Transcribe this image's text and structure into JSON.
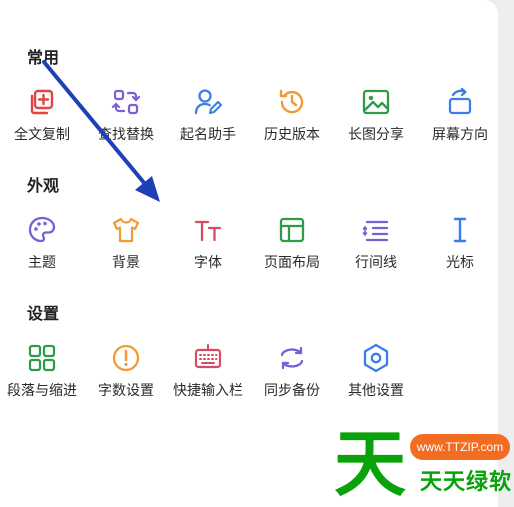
{
  "sections": {
    "common": {
      "title": "常用",
      "items": [
        {
          "label": "全文复制",
          "icon": "copy-plus-icon"
        },
        {
          "label": "查找替换",
          "icon": "find-replace-icon"
        },
        {
          "label": "起名助手",
          "icon": "person-edit-icon"
        },
        {
          "label": "历史版本",
          "icon": "history-icon"
        },
        {
          "label": "长图分享",
          "icon": "image-icon"
        },
        {
          "label": "屏幕方向",
          "icon": "rotate-icon"
        }
      ]
    },
    "appearance": {
      "title": "外观",
      "items": [
        {
          "label": "主题",
          "icon": "palette-icon"
        },
        {
          "label": "背景",
          "icon": "tshirt-icon"
        },
        {
          "label": "字体",
          "icon": "font-icon"
        },
        {
          "label": "页面布局",
          "icon": "layout-icon"
        },
        {
          "label": "行间线",
          "icon": "line-spacing-icon"
        },
        {
          "label": "光标",
          "icon": "cursor-icon"
        }
      ]
    },
    "settings": {
      "title": "设置",
      "items": [
        {
          "label": "段落与缩进",
          "icon": "grid-icon"
        },
        {
          "label": "字数设置",
          "icon": "alert-circle-icon"
        },
        {
          "label": "快捷输入栏",
          "icon": "keyboard-icon"
        },
        {
          "label": "同步备份",
          "icon": "sync-icon"
        },
        {
          "label": "其他设置",
          "icon": "gear-icon"
        }
      ]
    }
  },
  "colors": {
    "red": "#e0453f",
    "purple": "#7b5fd6",
    "blue": "#3b7ee8",
    "orange": "#f39a35",
    "green": "#2e9b49",
    "pink": "#d64b63",
    "arrow": "#1f3fb8"
  },
  "watermark": {
    "url": "www.TTZIP.com",
    "big_char": "天",
    "text": "天天绿软"
  }
}
